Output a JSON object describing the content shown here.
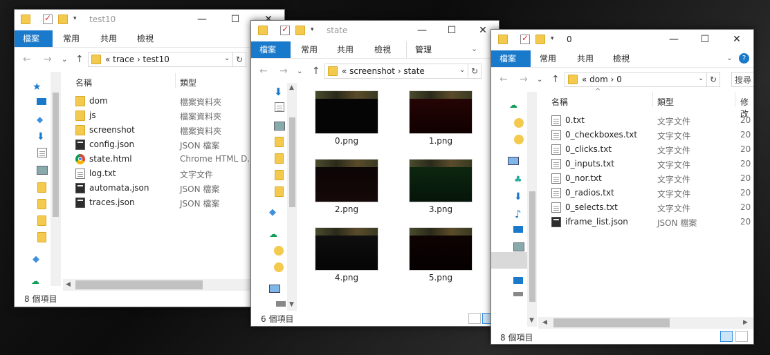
{
  "win1": {
    "title": "test10",
    "tabs": [
      "檔案",
      "常用",
      "共用",
      "檢視"
    ],
    "addr": "«  trace  ›  test10",
    "col_name": "名稱",
    "col_type": "類型",
    "files": [
      {
        "name": "dom",
        "type": "檔案資料夾",
        "icon": "folder"
      },
      {
        "name": "js",
        "type": "檔案資料夾",
        "icon": "folder"
      },
      {
        "name": "screenshot",
        "type": "檔案資料夾",
        "icon": "folder"
      },
      {
        "name": "config.json",
        "type": "JSON 檔案",
        "icon": "json"
      },
      {
        "name": "state.html",
        "type": "Chrome HTML D...",
        "icon": "chrome"
      },
      {
        "name": "log.txt",
        "type": "文字文件",
        "icon": "txt"
      },
      {
        "name": "automata.json",
        "type": "JSON 檔案",
        "icon": "json"
      },
      {
        "name": "traces.json",
        "type": "JSON 檔案",
        "icon": "json"
      }
    ],
    "status": "8 個項目"
  },
  "win2": {
    "title": "state",
    "tabs": [
      "檔案",
      "常用",
      "共用",
      "檢視",
      "管理"
    ],
    "addr": "«  screenshot  ›  state",
    "thumbs": [
      "0.png",
      "1.png",
      "2.png",
      "3.png",
      "4.png",
      "5.png"
    ],
    "status": "6 個項目"
  },
  "win3": {
    "title": "0",
    "tabs": [
      "檔案",
      "常用",
      "共用",
      "檢視"
    ],
    "addr": "«  dom  ›  0",
    "search": "搜尋",
    "col_name": "名稱",
    "col_type": "類型",
    "col_mod": "修改",
    "files": [
      {
        "name": "0.txt",
        "type": "文字文件",
        "icon": "txt",
        "mod": "20"
      },
      {
        "name": "0_checkboxes.txt",
        "type": "文字文件",
        "icon": "txt",
        "mod": "20"
      },
      {
        "name": "0_clicks.txt",
        "type": "文字文件",
        "icon": "txt",
        "mod": "20"
      },
      {
        "name": "0_inputs.txt",
        "type": "文字文件",
        "icon": "txt",
        "mod": "20"
      },
      {
        "name": "0_nor.txt",
        "type": "文字文件",
        "icon": "txt",
        "mod": "20"
      },
      {
        "name": "0_radios.txt",
        "type": "文字文件",
        "icon": "txt",
        "mod": "20"
      },
      {
        "name": "0_selects.txt",
        "type": "文字文件",
        "icon": "txt",
        "mod": "20"
      },
      {
        "name": "iframe_list.json",
        "type": "JSON 檔案",
        "icon": "json",
        "mod": "20"
      }
    ],
    "status": "8 個項目"
  },
  "colors": {
    "accent": "#1979ca",
    "folder": "#f3c94e"
  }
}
